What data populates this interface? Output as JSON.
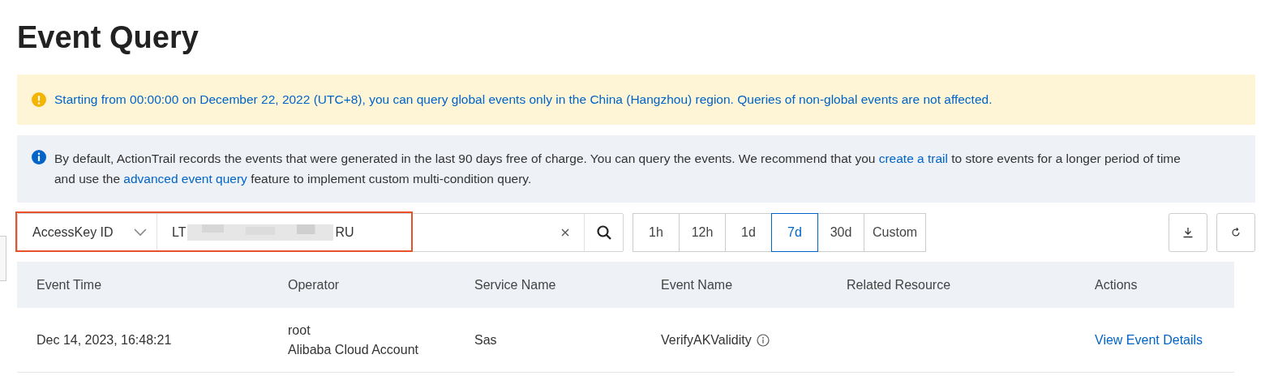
{
  "title": "Event Query",
  "warning_banner": {
    "text": "Starting from 00:00:00 on December 22, 2022 (UTC+8), you can query global events only in the China (Hangzhou) region. Queries of non-global events are not affected."
  },
  "info_banner": {
    "parts": [
      {
        "kind": "text",
        "text": "By default, ActionTrail records the events that were generated in the last 90 days free of charge. You can query the events. We recommend that you "
      },
      {
        "kind": "link",
        "text": "create a trail"
      },
      {
        "kind": "text",
        "text": " to store events for a longer period of time and use the "
      },
      {
        "kind": "link",
        "text": "advanced event query"
      },
      {
        "kind": "text",
        "text": " feature to implement custom multi-condition query."
      }
    ]
  },
  "filter": {
    "field": "AccessKey ID",
    "value_start": "LT",
    "value_end": "RU",
    "redacted": true,
    "highlighted": true
  },
  "time_ranges": [
    {
      "label": "1h",
      "selected": false
    },
    {
      "label": "12h",
      "selected": false
    },
    {
      "label": "1d",
      "selected": false
    },
    {
      "label": "7d",
      "selected": true
    },
    {
      "label": "30d",
      "selected": false
    },
    {
      "label": "Custom",
      "selected": false
    }
  ],
  "table": {
    "columns": [
      "Event Time",
      "Operator",
      "Service Name",
      "Event Name",
      "Related Resource",
      "Actions"
    ],
    "rows": [
      {
        "event_time": "Dec 14, 2023, 16:48:21",
        "operator": "root",
        "operator_type": "Alibaba Cloud Account",
        "service_name": "Sas",
        "event_name": "VerifyAKValidity",
        "action": "View Event Details"
      }
    ]
  }
}
